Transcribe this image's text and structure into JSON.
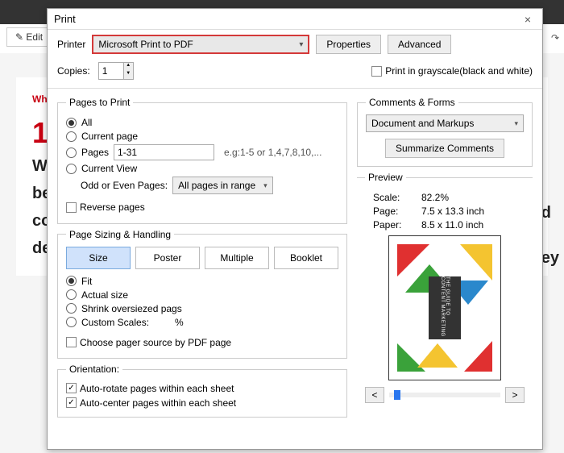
{
  "backdrop": {
    "edit": "Edit",
    "red": "Wh",
    "num": "1",
    "lines": [
      "W",
      "be",
      "co",
      "de"
    ],
    "right_lines": [
      "d",
      "ey"
    ]
  },
  "dialog": {
    "title": "Print",
    "close": "×",
    "printer_label": "Printer",
    "printer_value": "Microsoft Print to PDF",
    "properties": "Properties",
    "advanced": "Advanced",
    "copies_label": "Copies:",
    "copies_value": "1",
    "grayscale": "Print in grayscale(black and white)",
    "pages_to_print": {
      "legend": "Pages to Print",
      "all": "All",
      "current": "Current page",
      "pages": "Pages",
      "pages_value": "1-31",
      "eg": "e.g:1-5 or 1,4,7,8,10,...",
      "current_view": "Current View",
      "odd_even_label": "Odd or Even Pages:",
      "odd_even_value": "All pages in range",
      "reverse": "Reverse pages"
    },
    "sizing": {
      "legend": "Page Sizing & Handling",
      "tabs": [
        "Size",
        "Poster",
        "Multiple",
        "Booklet"
      ],
      "fit": "Fit",
      "actual": "Actual size",
      "shrink": "Shrink oversiezed pags",
      "custom": "Custom Scales:",
      "custom_unit": "%",
      "choose_source": "Choose pager source by PDF page"
    },
    "orientation": {
      "legend": "Orientation:",
      "auto_rotate": "Auto-rotate pages within each sheet",
      "auto_center": "Auto-center pages within each sheet"
    },
    "comments": {
      "legend": "Comments & Forms",
      "value": "Document and Markups",
      "summarize": "Summarize Comments"
    },
    "preview": {
      "legend": "Preview",
      "scale_label": "Scale:",
      "scale_value": "82.2%",
      "page_label": "Page:",
      "page_value": "7.5 x 13.3 inch",
      "paper_label": "Paper:",
      "paper_value": "8.5 x 11.0 inch",
      "prev": "<",
      "next": ">",
      "badge": "THE GUIDE TO CONTENT MARKETING"
    }
  },
  "icons": {
    "pencil": "✎",
    "redo": "↷"
  }
}
